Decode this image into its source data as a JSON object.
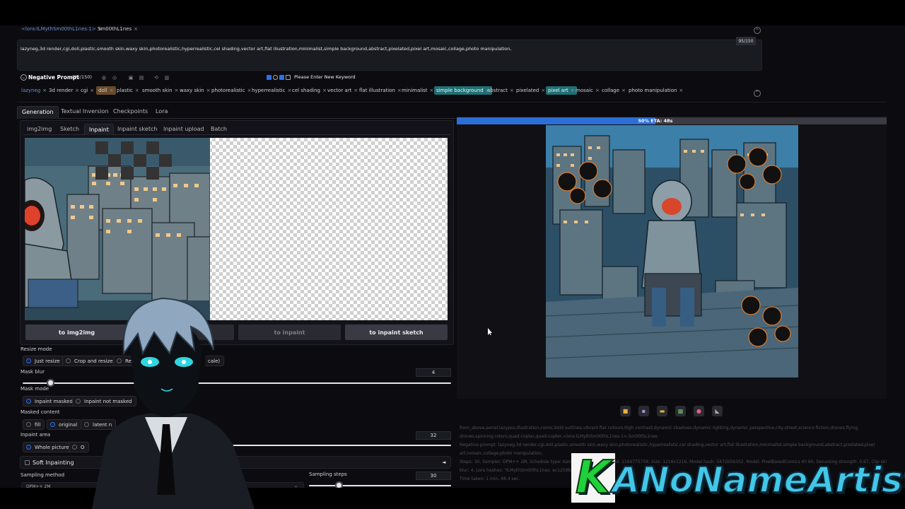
{
  "prompt": {
    "lora_tags": [
      "<lora:ILMythSm00thL1nes:1>",
      "Sm00thL1nes"
    ],
    "positive_text": "lazyneg,3d render,cgi,doll,plastic,smooth skin,waxy skin,photorealistic,hyperrealistic,cel shading,vector art,flat illustration,minimalist,simple background,abstract,pixelated,pixel art,mosaic,collage,photo manipulation,",
    "token_count": "95/150"
  },
  "negative": {
    "title": "Negative Prompt",
    "count": "(95/150)",
    "keyword_placeholder": "Please Enter New Keyword",
    "tags": [
      "lazyneg",
      "3d render",
      "cgi",
      "doll",
      "plastic",
      "smooth skin",
      "waxy skin",
      "photorealistic",
      "hyperrealistic",
      "cel shading",
      "vector art",
      "flat illustration",
      "minimalist",
      "simple background",
      "abstract",
      "pixelated",
      "pixel art",
      "mosaic",
      "collage",
      "photo manipulation"
    ]
  },
  "main_tabs": [
    "Generation",
    "Textual Inversion",
    "Checkpoints",
    "Lora"
  ],
  "sub_tabs": [
    "img2img",
    "Sketch",
    "Inpaint",
    "Inpaint sketch",
    "Inpaint upload",
    "Batch"
  ],
  "buttons": {
    "to_img2img": "to img2img",
    "to_inpaint": "to inpaint",
    "to_inpaint_sketch": "to inpaint sketch"
  },
  "resize": {
    "label": "Resize mode",
    "options": [
      "Just resize",
      "Crop and resize",
      "Re",
      "cale)"
    ]
  },
  "mask_blur": {
    "label": "Mask blur",
    "value": "4",
    "level": 0.065
  },
  "mask_mode": {
    "label": "Mask mode",
    "options": [
      "Inpaint masked",
      "Inpaint not masked"
    ]
  },
  "masked_content": {
    "label": "Masked content",
    "options": [
      "fill",
      "original",
      "latent n"
    ]
  },
  "inpaint_area": {
    "label": "Inpaint area",
    "value": "32",
    "options": [
      "Whole picture",
      "O"
    ]
  },
  "soft_inpainting": {
    "label": "Soft Inpainting",
    "icon": "◄"
  },
  "sampling_method": {
    "label": "Sampling method",
    "value": "DPM++ 2M"
  },
  "sampling_steps": {
    "label": "Sampling steps",
    "value": "30",
    "level": 0.21
  },
  "progress": {
    "text": "50% ETA: 48s",
    "level": 0.5
  },
  "info_lines": [
    "from_above,aerial,lazypos,illustration,comic,bold outlines,vibrant flat colours,high contrast,dynamic shadows,dynamic lighting,dynamic perspective,city,street,science fiction,drones,flying",
    "drones,spinning rotors,quad-copter,quad-copter,<lora:ILMythSm00thL1nes:1>,Sm00thL1nes",
    "Negative prompt: lazyneg,3d render,cgi,doll,plastic,smooth skin,waxy skin,photorealistic,hyperrealistic,cel shading,vector art,flat illustration,minimalist,simple background,abstract,pixelated,pixel",
    "art,mosaic,collage,photo manipulation,",
    "Steps: 30, Sampler: DPM++ 2M, Schedule type: Karras, CFG scale: 7, Seed: 1169775758, Size: 1216x1216, Model hash: 5472b5b352, Model: PixelBasedComics 40 60, Denoising strength: 0.67, Clip skip: 2, Mask",
    "blur: 4, Lora hashes: \"ILMythSm00thL1nes: ec1259b...\"",
    "Time taken: 1 min. 48.4 sec."
  ],
  "result_icons": [
    "folder-icon",
    "save-icon",
    "zip-icon",
    "image-icon",
    "palette-icon",
    "ruler-icon"
  ],
  "watermark": {
    "letter": "K",
    "name": "ANoNameArtist"
  },
  "colors": {
    "accent": "#2f6fe6",
    "tag_highlight": "#1f6f73",
    "progress": "#2b6fd6",
    "watermark": "#42c7e8"
  }
}
